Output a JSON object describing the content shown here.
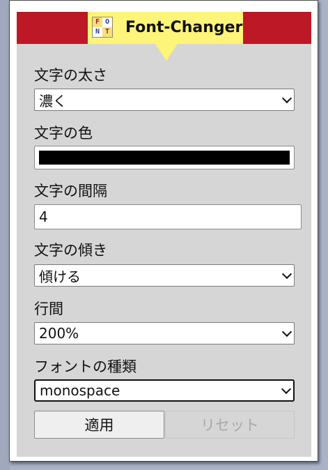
{
  "header": {
    "title": "Font-Changer",
    "logo_letters": [
      "F",
      "O",
      "N",
      "T"
    ],
    "accent_red": "#bd1826",
    "accent_yellow": "#fdf47a"
  },
  "form": {
    "weight": {
      "label": "文字の太さ",
      "value": "濃く"
    },
    "color": {
      "label": "文字の色",
      "value": "#000000"
    },
    "spacing": {
      "label": "文字の間隔",
      "value": "4"
    },
    "slant": {
      "label": "文字の傾き",
      "value": "傾ける"
    },
    "line_height": {
      "label": "行間",
      "value": "200%"
    },
    "family": {
      "label": "フォントの種類",
      "value": "monospace"
    }
  },
  "buttons": {
    "apply": "適用",
    "reset": "リセット"
  }
}
